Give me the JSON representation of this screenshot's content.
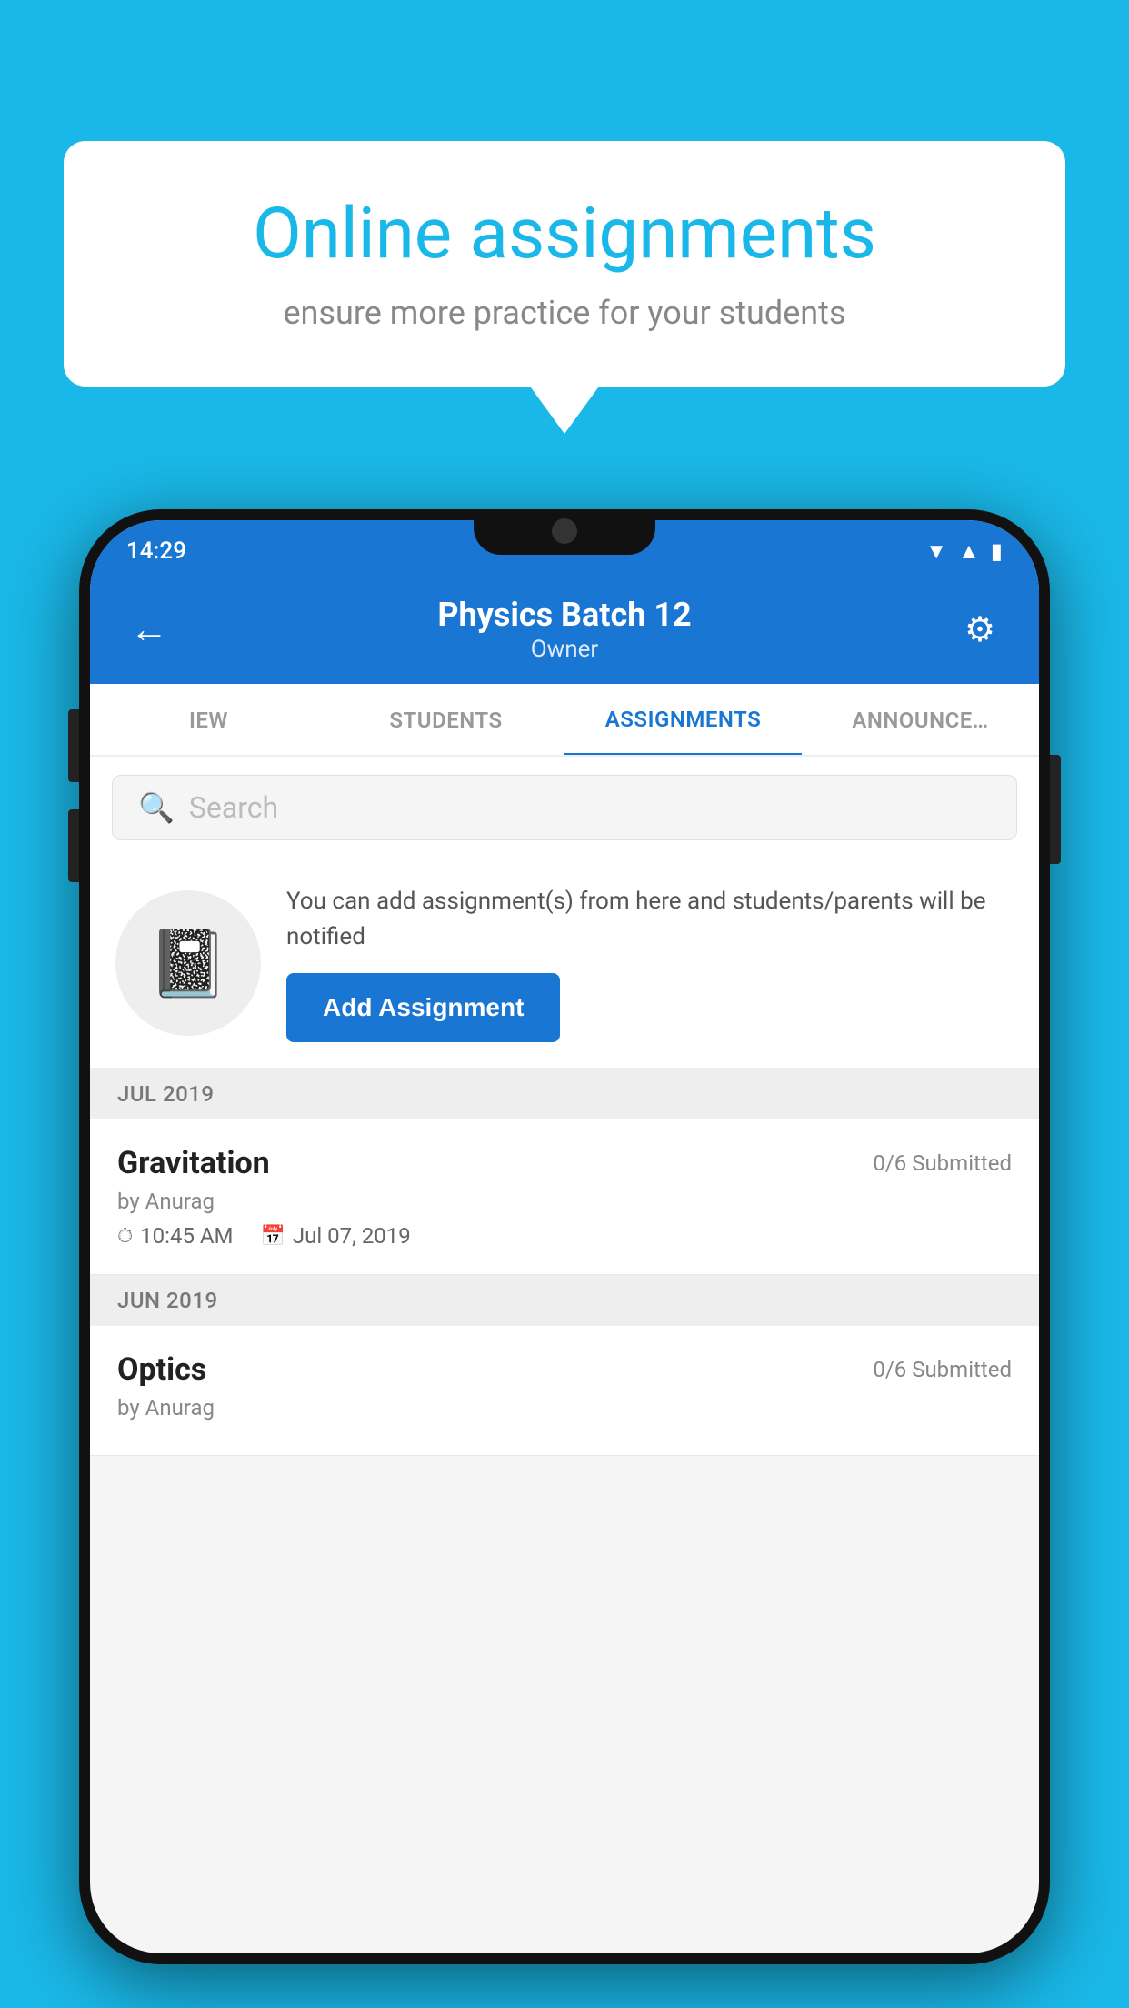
{
  "background_color": "#1ab8e8",
  "speech_bubble": {
    "title": "Online assignments",
    "subtitle": "ensure more practice for your students"
  },
  "phone": {
    "status_bar": {
      "time": "14:29",
      "wifi": "▾",
      "signal": "▲",
      "battery": "▮"
    },
    "app_bar": {
      "title": "Physics Batch 12",
      "subtitle": "Owner",
      "back_label": "←",
      "settings_label": "⚙"
    },
    "tabs": [
      {
        "label": "IEW",
        "active": false
      },
      {
        "label": "STUDENTS",
        "active": false
      },
      {
        "label": "ASSIGNMENTS",
        "active": true
      },
      {
        "label": "ANNOUNCE…",
        "active": false
      }
    ],
    "search": {
      "placeholder": "Search"
    },
    "promo": {
      "description": "You can add assignment(s) from here and students/parents will be notified",
      "button_label": "Add Assignment"
    },
    "sections": [
      {
        "header": "JUL 2019",
        "assignments": [
          {
            "name": "Gravitation",
            "submitted": "0/6 Submitted",
            "by": "by Anurag",
            "time": "10:45 AM",
            "date": "Jul 07, 2019"
          }
        ]
      },
      {
        "header": "JUN 2019",
        "assignments": [
          {
            "name": "Optics",
            "submitted": "0/6 Submitted",
            "by": "by Anurag",
            "time": "",
            "date": ""
          }
        ]
      }
    ]
  }
}
